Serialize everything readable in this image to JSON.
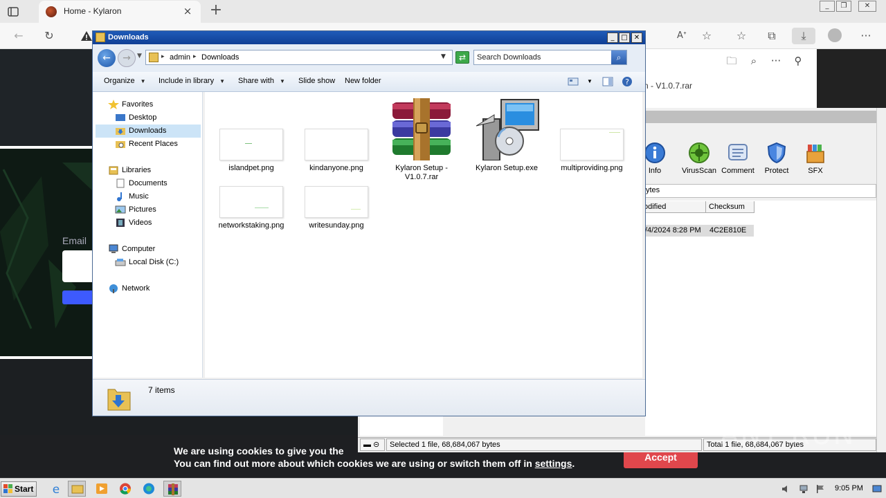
{
  "browser": {
    "tab_title": "Home - Kylaron",
    "tab_close": "×",
    "new_tab": "+",
    "toolbar_icons": [
      "back-icon",
      "refresh-icon",
      "warning-icon",
      "read-aloud-icon",
      "add-favorite-icon",
      "favorites-icon",
      "collections-icon",
      "downloads-icon",
      "profile-icon",
      "more-icon"
    ]
  },
  "downloads_flyout": {
    "item_text": "n - V1.0.7.rar",
    "icons": [
      "open-folder-icon",
      "search-icon",
      "more-icon",
      "pin-icon"
    ]
  },
  "website": {
    "email_label": "Email",
    "cookie_line1": "We are using cookies to give you the",
    "cookie_line2_prefix": "You can find out more about which cookies we are using or switch them off in ",
    "cookie_link": "settings",
    "cookie_line2_suffix": ".",
    "accept_label": "Accept"
  },
  "winrar": {
    "tools": [
      {
        "label": "Info",
        "icon": "info-icon"
      },
      {
        "label": "VirusScan",
        "icon": "virus-scan-icon"
      },
      {
        "label": "Comment",
        "icon": "comment-icon"
      },
      {
        "label": "Protect",
        "icon": "shield-icon"
      },
      {
        "label": "SFX",
        "icon": "sfx-icon"
      }
    ],
    "path_text": "ytes",
    "columns": [
      "odified",
      "Checksum"
    ],
    "row": {
      "modified": "/4/2024 8:28 PM",
      "checksum": "4C2E810E"
    },
    "status_selected": "Selected 1 file, 68,684,067 bytes",
    "status_total": "Total 1 file, 68,684,067 bytes",
    "watermark": "ANY RUN"
  },
  "explorer": {
    "title": "Downloads",
    "breadcrumb": [
      "admin",
      "Downloads"
    ],
    "search_placeholder": "Search Downloads",
    "commands": [
      "Organize",
      "Include in library",
      "Share with",
      "Slide show",
      "New folder"
    ],
    "nav": {
      "favorites": "Favorites",
      "favorites_items": [
        "Desktop",
        "Downloads",
        "Recent Places"
      ],
      "libraries": "Libraries",
      "libraries_items": [
        "Documents",
        "Music",
        "Pictures",
        "Videos"
      ],
      "computer": "Computer",
      "computer_items": [
        "Local Disk (C:)"
      ],
      "network": "Network"
    },
    "files": [
      {
        "name": "islandpet.png",
        "type": "png"
      },
      {
        "name": "kindanyone.png",
        "type": "png"
      },
      {
        "name": "Kylaron Setup - V1.0.7.rar",
        "type": "rar"
      },
      {
        "name": "Kylaron Setup.exe",
        "type": "exe"
      },
      {
        "name": "multiproviding.png",
        "type": "png"
      },
      {
        "name": "networkstaking.png",
        "type": "png"
      },
      {
        "name": "writesunday.png",
        "type": "png"
      }
    ],
    "item_count": "7 items"
  },
  "taskbar": {
    "start_label": "Start",
    "clock": "9:05 PM"
  }
}
